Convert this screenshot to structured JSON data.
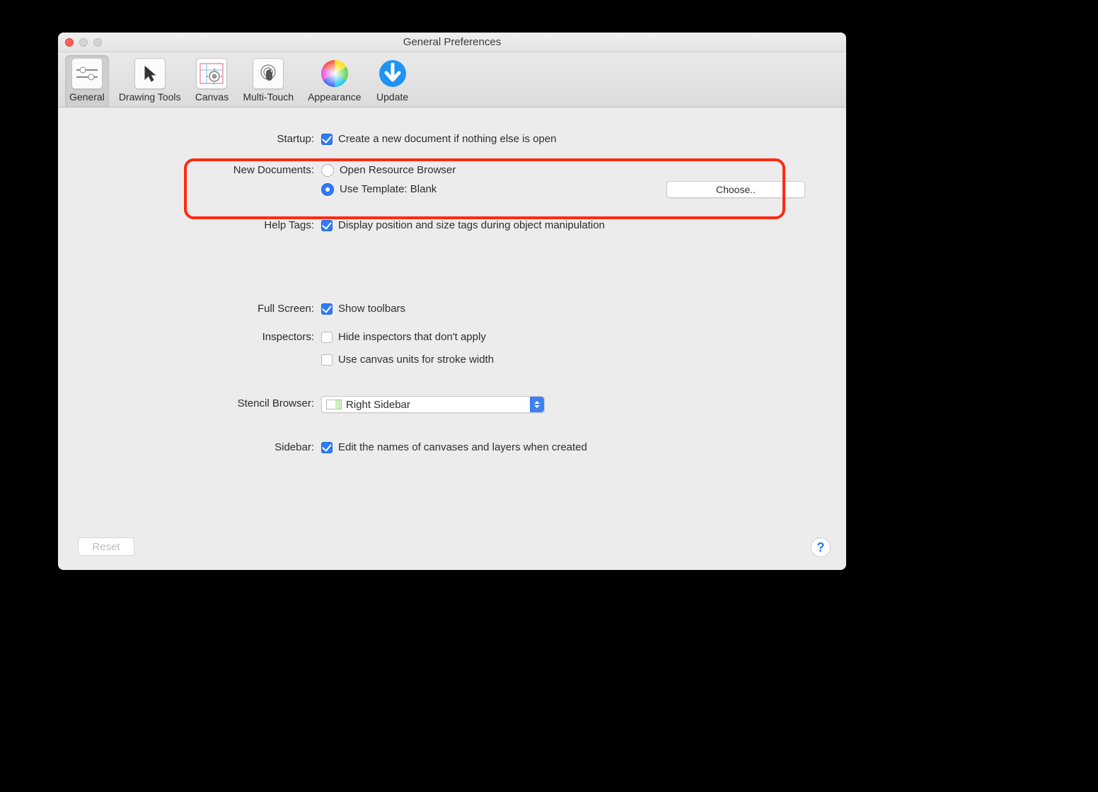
{
  "window": {
    "title": "General Preferences"
  },
  "toolbar": {
    "items": [
      {
        "label": "General"
      },
      {
        "label": "Drawing Tools"
      },
      {
        "label": "Canvas"
      },
      {
        "label": "Multi-Touch"
      },
      {
        "label": "Appearance"
      },
      {
        "label": "Update"
      }
    ]
  },
  "sections": {
    "startup": {
      "label": "Startup:",
      "checkbox": "Create a new document if nothing else is open"
    },
    "new_documents": {
      "label": "New Documents:",
      "radio1": "Open Resource Browser",
      "radio2": "Use Template: Blank",
      "choose": "Choose.."
    },
    "help_tags": {
      "label": "Help Tags:",
      "checkbox": "Display position and size tags during object manipulation"
    },
    "full_screen": {
      "label": "Full Screen:",
      "checkbox": "Show toolbars"
    },
    "inspectors": {
      "label": "Inspectors:",
      "c1": "Hide inspectors that don't apply",
      "c2": "Use canvas units for stroke width"
    },
    "stencil": {
      "label": "Stencil Browser:",
      "value": "Right Sidebar"
    },
    "sidebar": {
      "label": "Sidebar:",
      "checkbox": "Edit the names of canvases and layers when created"
    }
  },
  "footer": {
    "reset": "Reset",
    "help": "?"
  }
}
